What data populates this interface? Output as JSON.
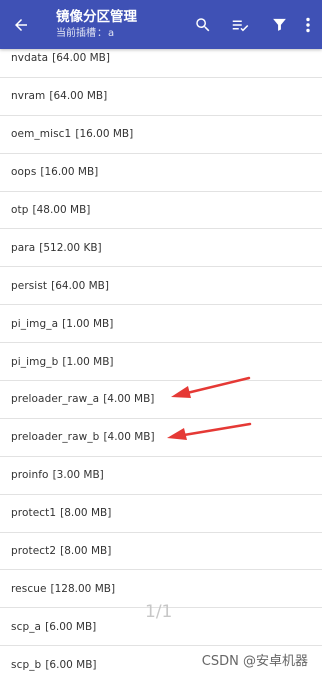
{
  "header": {
    "title": "镜像分区管理",
    "subtitle_label": "当前插槽",
    "subtitle_sep": "：",
    "subtitle_value": "a",
    "background": "#3f51b5"
  },
  "actions": {
    "search_icon": "search-icon",
    "sort_icon": "sort-check-icon",
    "filter_icon": "filter-icon",
    "more_icon": "more-vertical-icon"
  },
  "partitions": [
    {
      "name": "nvdata",
      "size": "[64.00 MB]"
    },
    {
      "name": "nvram",
      "size": "[64.00 MB]"
    },
    {
      "name": "oem_misc1",
      "size": "[16.00 MB]"
    },
    {
      "name": "oops",
      "size": "[16.00 MB]"
    },
    {
      "name": "otp",
      "size": "[48.00 MB]"
    },
    {
      "name": "para",
      "size": "[512.00 KB]"
    },
    {
      "name": "persist",
      "size": "[64.00 MB]"
    },
    {
      "name": "pi_img_a",
      "size": "[1.00 MB]"
    },
    {
      "name": "pi_img_b",
      "size": "[1.00 MB]"
    },
    {
      "name": "preloader_raw_a",
      "size": "[4.00 MB]"
    },
    {
      "name": "preloader_raw_b",
      "size": "[4.00 MB]"
    },
    {
      "name": "proinfo",
      "size": "[3.00 MB]"
    },
    {
      "name": "protect1",
      "size": "[8.00 MB]"
    },
    {
      "name": "protect2",
      "size": "[8.00 MB]"
    },
    {
      "name": "rescue",
      "size": "[128.00 MB]"
    },
    {
      "name": "scp_a",
      "size": "[6.00 MB]"
    },
    {
      "name": "scp_b",
      "size": "[6.00 MB]"
    }
  ],
  "page_indicator": "1/1",
  "watermark": "CSDN @安卓机器",
  "annotation_color": "#e53935"
}
